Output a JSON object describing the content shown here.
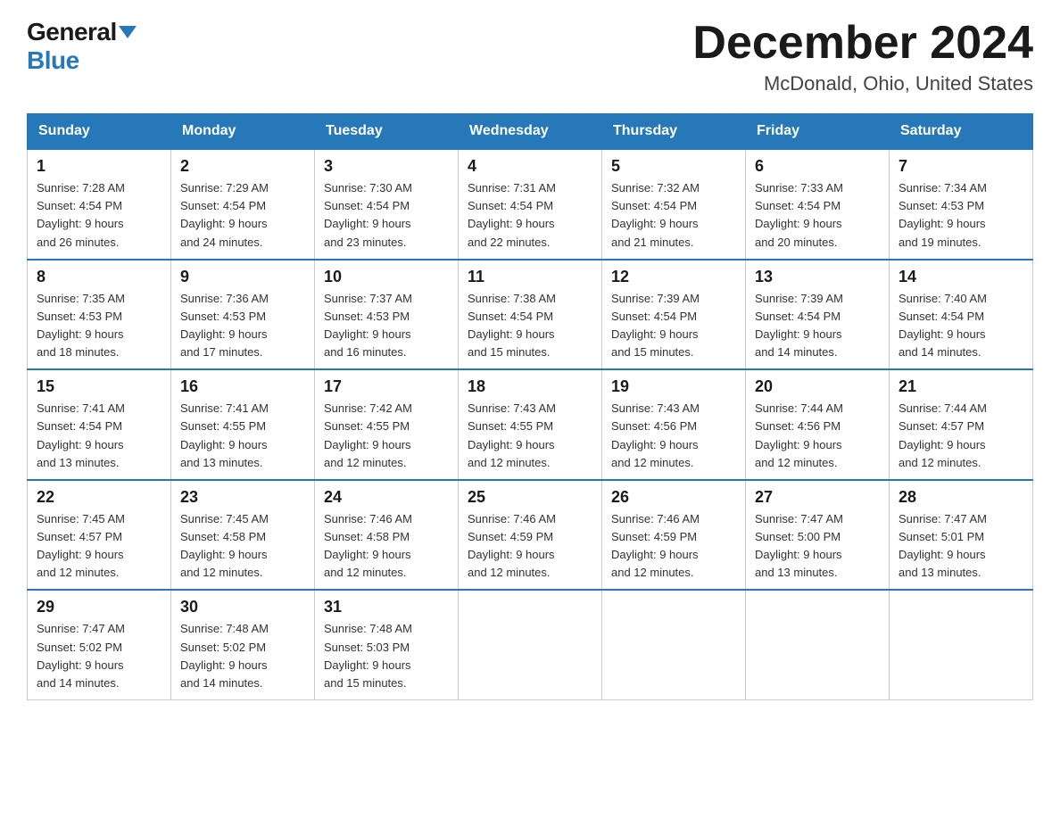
{
  "logo": {
    "general": "General",
    "blue": "Blue"
  },
  "header": {
    "month": "December 2024",
    "location": "McDonald, Ohio, United States"
  },
  "weekdays": [
    "Sunday",
    "Monday",
    "Tuesday",
    "Wednesday",
    "Thursday",
    "Friday",
    "Saturday"
  ],
  "weeks": [
    [
      {
        "day": "1",
        "sunrise": "7:28 AM",
        "sunset": "4:54 PM",
        "daylight": "9 hours and 26 minutes."
      },
      {
        "day": "2",
        "sunrise": "7:29 AM",
        "sunset": "4:54 PM",
        "daylight": "9 hours and 24 minutes."
      },
      {
        "day": "3",
        "sunrise": "7:30 AM",
        "sunset": "4:54 PM",
        "daylight": "9 hours and 23 minutes."
      },
      {
        "day": "4",
        "sunrise": "7:31 AM",
        "sunset": "4:54 PM",
        "daylight": "9 hours and 22 minutes."
      },
      {
        "day": "5",
        "sunrise": "7:32 AM",
        "sunset": "4:54 PM",
        "daylight": "9 hours and 21 minutes."
      },
      {
        "day": "6",
        "sunrise": "7:33 AM",
        "sunset": "4:54 PM",
        "daylight": "9 hours and 20 minutes."
      },
      {
        "day": "7",
        "sunrise": "7:34 AM",
        "sunset": "4:53 PM",
        "daylight": "9 hours and 19 minutes."
      }
    ],
    [
      {
        "day": "8",
        "sunrise": "7:35 AM",
        "sunset": "4:53 PM",
        "daylight": "9 hours and 18 minutes."
      },
      {
        "day": "9",
        "sunrise": "7:36 AM",
        "sunset": "4:53 PM",
        "daylight": "9 hours and 17 minutes."
      },
      {
        "day": "10",
        "sunrise": "7:37 AM",
        "sunset": "4:53 PM",
        "daylight": "9 hours and 16 minutes."
      },
      {
        "day": "11",
        "sunrise": "7:38 AM",
        "sunset": "4:54 PM",
        "daylight": "9 hours and 15 minutes."
      },
      {
        "day": "12",
        "sunrise": "7:39 AM",
        "sunset": "4:54 PM",
        "daylight": "9 hours and 15 minutes."
      },
      {
        "day": "13",
        "sunrise": "7:39 AM",
        "sunset": "4:54 PM",
        "daylight": "9 hours and 14 minutes."
      },
      {
        "day": "14",
        "sunrise": "7:40 AM",
        "sunset": "4:54 PM",
        "daylight": "9 hours and 14 minutes."
      }
    ],
    [
      {
        "day": "15",
        "sunrise": "7:41 AM",
        "sunset": "4:54 PM",
        "daylight": "9 hours and 13 minutes."
      },
      {
        "day": "16",
        "sunrise": "7:41 AM",
        "sunset": "4:55 PM",
        "daylight": "9 hours and 13 minutes."
      },
      {
        "day": "17",
        "sunrise": "7:42 AM",
        "sunset": "4:55 PM",
        "daylight": "9 hours and 12 minutes."
      },
      {
        "day": "18",
        "sunrise": "7:43 AM",
        "sunset": "4:55 PM",
        "daylight": "9 hours and 12 minutes."
      },
      {
        "day": "19",
        "sunrise": "7:43 AM",
        "sunset": "4:56 PM",
        "daylight": "9 hours and 12 minutes."
      },
      {
        "day": "20",
        "sunrise": "7:44 AM",
        "sunset": "4:56 PM",
        "daylight": "9 hours and 12 minutes."
      },
      {
        "day": "21",
        "sunrise": "7:44 AM",
        "sunset": "4:57 PM",
        "daylight": "9 hours and 12 minutes."
      }
    ],
    [
      {
        "day": "22",
        "sunrise": "7:45 AM",
        "sunset": "4:57 PM",
        "daylight": "9 hours and 12 minutes."
      },
      {
        "day": "23",
        "sunrise": "7:45 AM",
        "sunset": "4:58 PM",
        "daylight": "9 hours and 12 minutes."
      },
      {
        "day": "24",
        "sunrise": "7:46 AM",
        "sunset": "4:58 PM",
        "daylight": "9 hours and 12 minutes."
      },
      {
        "day": "25",
        "sunrise": "7:46 AM",
        "sunset": "4:59 PM",
        "daylight": "9 hours and 12 minutes."
      },
      {
        "day": "26",
        "sunrise": "7:46 AM",
        "sunset": "4:59 PM",
        "daylight": "9 hours and 12 minutes."
      },
      {
        "day": "27",
        "sunrise": "7:47 AM",
        "sunset": "5:00 PM",
        "daylight": "9 hours and 13 minutes."
      },
      {
        "day": "28",
        "sunrise": "7:47 AM",
        "sunset": "5:01 PM",
        "daylight": "9 hours and 13 minutes."
      }
    ],
    [
      {
        "day": "29",
        "sunrise": "7:47 AM",
        "sunset": "5:02 PM",
        "daylight": "9 hours and 14 minutes."
      },
      {
        "day": "30",
        "sunrise": "7:48 AM",
        "sunset": "5:02 PM",
        "daylight": "9 hours and 14 minutes."
      },
      {
        "day": "31",
        "sunrise": "7:48 AM",
        "sunset": "5:03 PM",
        "daylight": "9 hours and 15 minutes."
      },
      null,
      null,
      null,
      null
    ]
  ],
  "labels": {
    "sunrise": "Sunrise:",
    "sunset": "Sunset:",
    "daylight": "Daylight:"
  }
}
